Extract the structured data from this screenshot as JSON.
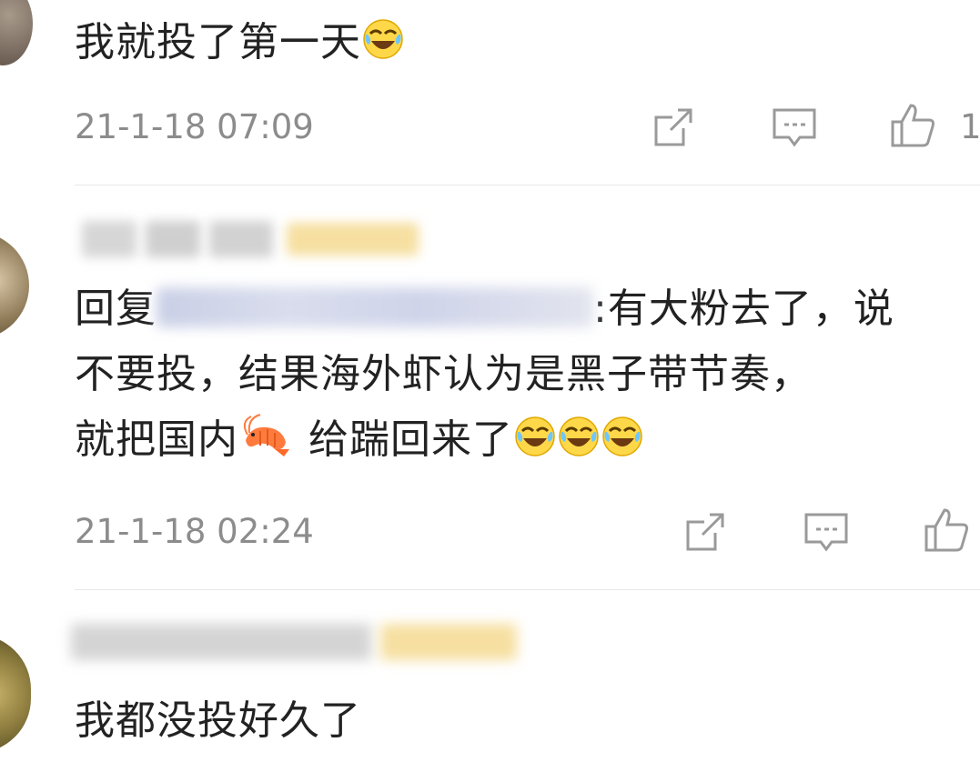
{
  "comments": [
    {
      "text": "我就投了第一天",
      "time": "21-1-18 07:09",
      "likes": "1"
    },
    {
      "reply_prefix": "回复",
      "text_line1": ":有大粉去了，说",
      "text_line2": "不要投，结果海外虾认为是黑子带节奏，",
      "text_line3a": "就把国内",
      "text_line3b": "给踹回来了",
      "time": "21-1-18 02:24"
    },
    {
      "text": "我都没投好久了"
    }
  ],
  "icons": {
    "repost": "repost-icon",
    "comment": "comment-icon",
    "like": "thumbs-up-icon",
    "emoji": "laugh-cry-emoji",
    "shrimp": "shrimp-emoji"
  },
  "colors": {
    "meta_text": "#8c8c8c",
    "main_text": "#222222",
    "icon_stroke": "#9a9a9a",
    "highlight_blur": "#f6dfa0"
  }
}
